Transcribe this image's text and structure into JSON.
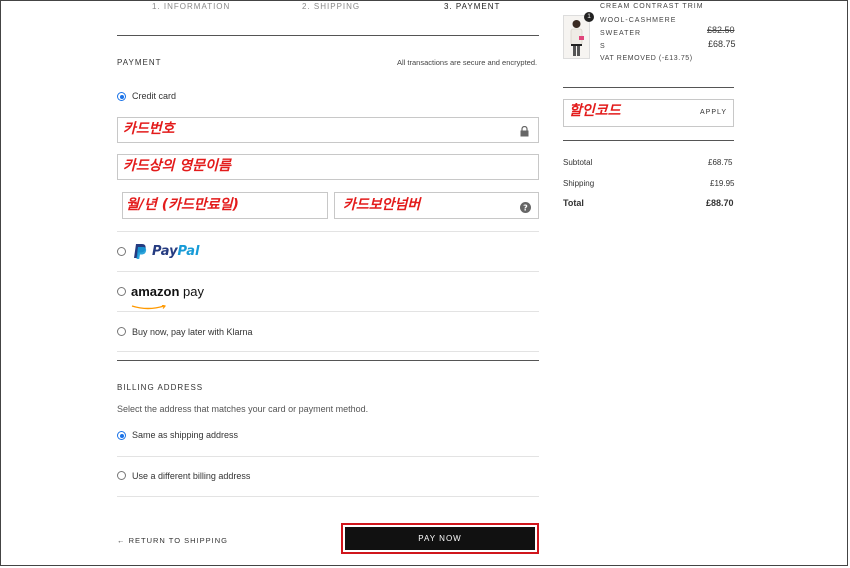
{
  "steps": [
    "1. INFORMATION",
    "2. SHIPPING",
    "3. PAYMENT"
  ],
  "payment": {
    "heading": "PAYMENT",
    "secure_note": "All transactions are secure and encrypted.",
    "credit_card_label": "Credit card",
    "card_number_overlay": "카드번호",
    "name_on_card_overlay": "카드상의 영문이름",
    "expiry_overlay": "월/년 (카드만료일)",
    "security_code_overlay": "카드보안넘버",
    "paypal_a": "Pay",
    "paypal_b": "Pal",
    "amazon_a": "amazon",
    "amazon_b": "pay",
    "klarna_label": "Buy now, pay later with Klarna"
  },
  "billing": {
    "heading": "BILLING ADDRESS",
    "instructions": "Select the address that matches your card or payment method.",
    "same_label": "Same as shipping address",
    "different_label": "Use a different billing address"
  },
  "footer": {
    "return_label": "← RETURN TO SHIPPING",
    "pay_now_label": "PAY NOW"
  },
  "order": {
    "item_qty": "1",
    "item_name_1": "CREAM CONTRAST TRIM",
    "item_name_2": "WOOL-CASHMERE",
    "item_name_3": "SWEATER",
    "item_size": "S",
    "item_old_price": "£82.50",
    "item_price": "£68.75",
    "vat_note": "VAT REMOVED (-£13.75)",
    "discount_overlay": "할인코드",
    "apply_label": "APPLY",
    "subtotal_label": "Subtotal",
    "subtotal_value": "£68.75",
    "shipping_label": "Shipping",
    "shipping_value": "£19.95",
    "total_label": "Total",
    "total_value": "£88.70"
  },
  "colors": {
    "accent": "#1a73e8",
    "overlay_red": "#e31b1b",
    "button": "#111111",
    "highlight": "#d0161c"
  }
}
